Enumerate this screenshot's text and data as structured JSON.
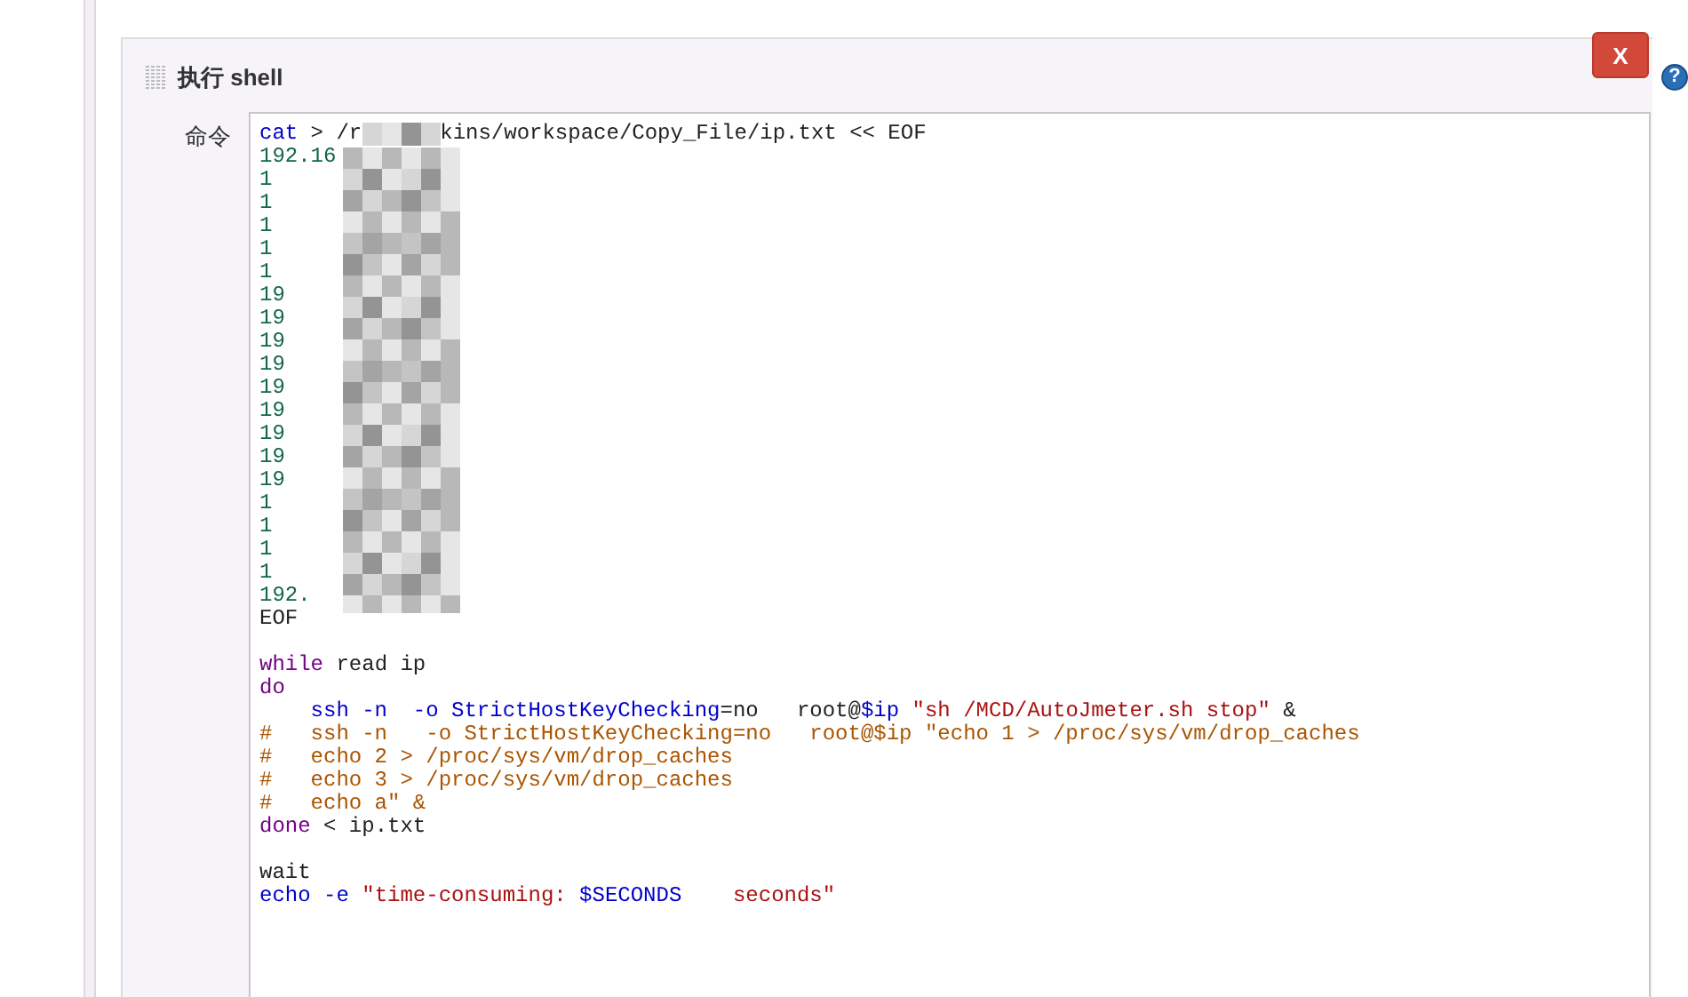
{
  "section": {
    "title": "执行 shell",
    "field_label": "命令",
    "close_button": "X",
    "help_button": "?"
  },
  "code_blocks": [
    {
      "lines": [
        {
          "tokens": [
            {
              "kind": "cmd",
              "text": "cat"
            },
            {
              "kind": "plain",
              "text": " > /r"
            },
            {
              "kind": "redacted"
            },
            {
              "kind": "plain",
              "text": "kins/workspace/Copy_File/ip.txt << EOF"
            }
          ]
        },
        {
          "tokens": [
            {
              "kind": "num",
              "text": "192.16"
            }
          ]
        },
        {
          "tokens": [
            {
              "kind": "num",
              "text": "1"
            }
          ]
        },
        {
          "tokens": [
            {
              "kind": "num",
              "text": "1"
            }
          ]
        },
        {
          "tokens": [
            {
              "kind": "num",
              "text": "1"
            }
          ]
        },
        {
          "tokens": [
            {
              "kind": "num",
              "text": "1"
            }
          ]
        },
        {
          "tokens": [
            {
              "kind": "num",
              "text": "1"
            }
          ]
        },
        {
          "tokens": [
            {
              "kind": "num",
              "text": "19"
            }
          ]
        },
        {
          "tokens": [
            {
              "kind": "num",
              "text": "19"
            }
          ]
        },
        {
          "tokens": [
            {
              "kind": "num",
              "text": "19"
            }
          ]
        },
        {
          "tokens": [
            {
              "kind": "num",
              "text": "19"
            }
          ]
        },
        {
          "tokens": [
            {
              "kind": "num",
              "text": "19"
            }
          ]
        },
        {
          "tokens": [
            {
              "kind": "num",
              "text": "19"
            }
          ]
        },
        {
          "tokens": [
            {
              "kind": "num",
              "text": "19"
            }
          ]
        },
        {
          "tokens": [
            {
              "kind": "num",
              "text": "19"
            }
          ]
        },
        {
          "tokens": [
            {
              "kind": "num",
              "text": "19"
            }
          ]
        },
        {
          "tokens": [
            {
              "kind": "num",
              "text": "1"
            }
          ]
        },
        {
          "tokens": [
            {
              "kind": "num",
              "text": "1"
            }
          ]
        },
        {
          "tokens": [
            {
              "kind": "num",
              "text": "1"
            }
          ]
        },
        {
          "tokens": [
            {
              "kind": "num",
              "text": "1"
            }
          ]
        },
        {
          "tokens": [
            {
              "kind": "num",
              "text": "192."
            }
          ]
        },
        {
          "tokens": [
            {
              "kind": "plain",
              "text": "EOF"
            }
          ]
        }
      ]
    },
    {
      "lines": [
        {
          "tokens": [
            {
              "kind": "keyword",
              "text": "while"
            },
            {
              "kind": "plain",
              "text": " read ip"
            }
          ]
        },
        {
          "tokens": [
            {
              "kind": "keyword",
              "text": "do"
            }
          ]
        },
        {
          "tokens": [
            {
              "kind": "cmd",
              "text": "    ssh -n  -o StrictHostKeyChecking"
            },
            {
              "kind": "plain",
              "text": "=no   root@"
            },
            {
              "kind": "cmd",
              "text": "$ip"
            },
            {
              "kind": "string",
              "text": " \"sh /MCD/AutoJmeter.sh stop\""
            },
            {
              "kind": "plain",
              "text": " &"
            }
          ]
        },
        {
          "tokens": [
            {
              "kind": "comment",
              "text": "#   ssh -n   -o StrictHostKeyChecking=no   root@$ip \"echo 1 > /proc/sys/vm/drop_caches"
            }
          ]
        },
        {
          "tokens": [
            {
              "kind": "comment",
              "text": "#   echo 2 > /proc/sys/vm/drop_caches"
            }
          ]
        },
        {
          "tokens": [
            {
              "kind": "comment",
              "text": "#   echo 3 > /proc/sys/vm/drop_caches"
            }
          ]
        },
        {
          "tokens": [
            {
              "kind": "comment",
              "text": "#   echo a\" &"
            }
          ]
        },
        {
          "tokens": [
            {
              "kind": "keyword",
              "text": "done"
            },
            {
              "kind": "plain",
              "text": " < ip.txt"
            }
          ]
        }
      ]
    },
    {
      "lines": [
        {
          "tokens": [
            {
              "kind": "plain",
              "text": "wait"
            }
          ]
        },
        {
          "tokens": [
            {
              "kind": "cmd",
              "text": "echo -e"
            },
            {
              "kind": "string",
              "text": " \"time-consuming: "
            },
            {
              "kind": "cmd",
              "text": "$SECONDS"
            },
            {
              "kind": "string",
              "text": "    seconds\""
            }
          ]
        }
      ]
    }
  ]
}
